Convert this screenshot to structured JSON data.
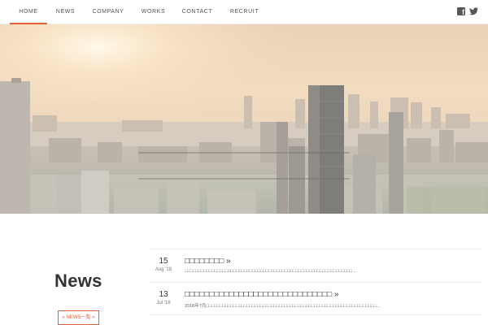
{
  "nav": {
    "items": [
      {
        "label": "HOME",
        "active": true
      },
      {
        "label": "NEWS",
        "active": false
      },
      {
        "label": "COMPANY",
        "active": false
      },
      {
        "label": "WORKS",
        "active": false
      },
      {
        "label": "CONTACT",
        "active": false
      },
      {
        "label": "RECRUIT",
        "active": false
      }
    ],
    "social": [
      "facebook-icon",
      "twitter-icon"
    ],
    "accent_color": "#e0613a"
  },
  "news": {
    "title": "News",
    "more_label": "» NEWS一覧 »",
    "items": [
      {
        "day": "15",
        "month_year": "Aug '18",
        "heading": "□□□□□□□□ »",
        "excerpt": "□□□□□□□□□□□□□□□□□□□□□□□□□□□□□□□□□□□□□□□□□□□□□□□□□□□□□□□□□□□□□□ ..."
      },
      {
        "day": "13",
        "month_year": "Jul '18",
        "heading": "□□□□□□□□□□□□□□□□□□□□□□□□□□□□□□ »",
        "excerpt": "2018年7月□□□□□□□□□□□□□□□□□□□□□□□□□□□□□□□□□□□□□□□□□□□□□□□□□□□□□□□□□□□□□□□..."
      }
    ]
  }
}
